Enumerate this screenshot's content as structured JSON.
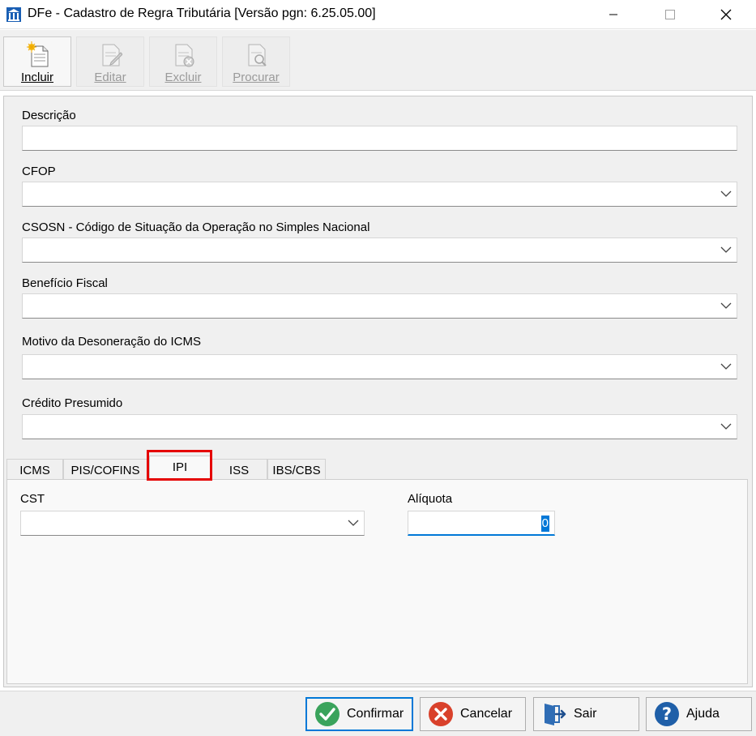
{
  "window": {
    "title": "DFe - Cadastro de Regra Tributária [Versão pgn: 6.25.05.00]",
    "controls": [
      "minimize-icon",
      "maximize-icon",
      "close-icon"
    ]
  },
  "toolbar": {
    "buttons": [
      {
        "label": "Incluir",
        "icon": "new-document-icon",
        "enabled": true
      },
      {
        "label": "Editar",
        "icon": "edit-document-icon",
        "enabled": false
      },
      {
        "label": "Excluir",
        "icon": "delete-document-icon",
        "enabled": false
      },
      {
        "label": "Procurar",
        "icon": "search-document-icon",
        "enabled": false
      }
    ]
  },
  "form": {
    "descricao": {
      "label": "Descrição",
      "value": ""
    },
    "cfop": {
      "label": "CFOP",
      "value": ""
    },
    "csosn": {
      "label": "CSOSN - Código de Situação da Operação no Simples Nacional",
      "value": ""
    },
    "beneficio": {
      "label": "Benefício Fiscal",
      "value": ""
    },
    "motivo": {
      "label": "Motivo da Desoneração do ICMS",
      "value": ""
    },
    "credito": {
      "label": "Crédito Presumido",
      "value": ""
    }
  },
  "tabs": {
    "items": [
      "ICMS",
      "PIS/COFINS",
      "IPI",
      "ISS",
      "IBS/CBS"
    ],
    "selected": "IPI"
  },
  "ipi": {
    "cst": {
      "label": "CST",
      "value": ""
    },
    "aliquota": {
      "label": "Alíquota",
      "value": "0"
    }
  },
  "buttons": {
    "confirmar": "Confirmar",
    "cancelar": "Cancelar",
    "sair": "Sair",
    "ajuda": "Ajuda"
  },
  "colors": {
    "accent": "#0078d7",
    "highlight": "#e50000",
    "confirm": "#3aa35c",
    "cancel": "#d9412b",
    "help": "#1f5fa8"
  }
}
